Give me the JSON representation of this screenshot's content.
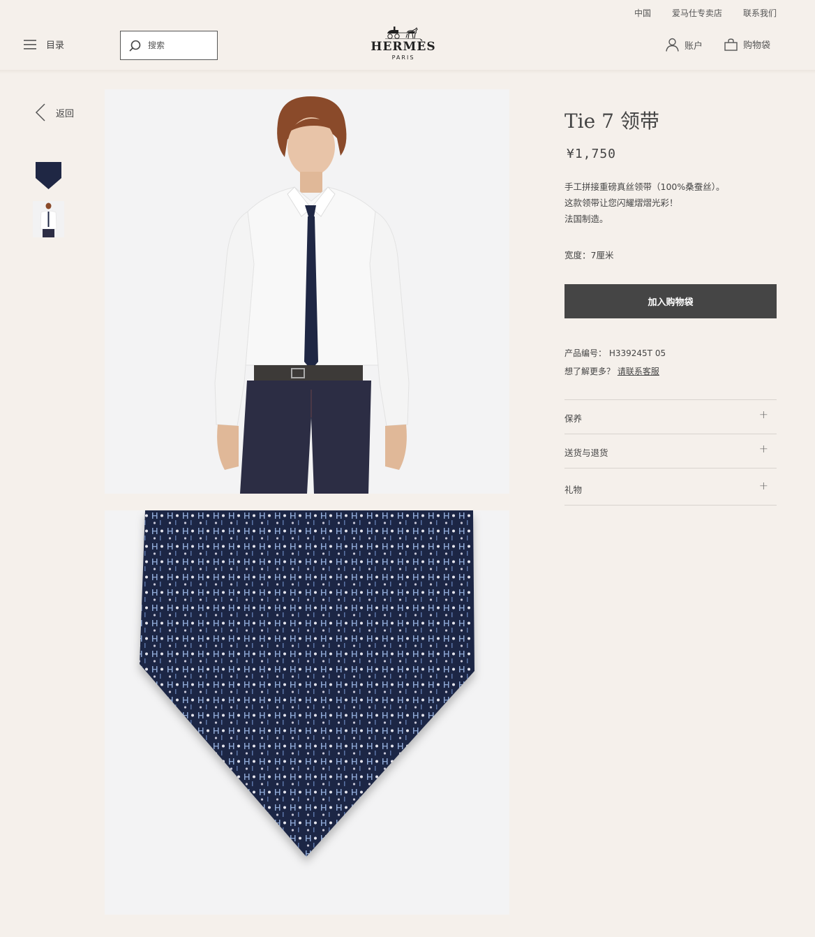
{
  "topbar": {
    "links": [
      "中国",
      "爱马仕专卖店",
      "联系我们"
    ]
  },
  "header": {
    "menu_label": "目录",
    "search_placeholder": "搜索",
    "logo_text": "HERMÈS",
    "logo_sub": "PARIS",
    "account_label": "账户",
    "bag_label": "购物袋"
  },
  "nav": {
    "back_label": "返回"
  },
  "product": {
    "title": "Tie 7 领带",
    "price": "¥1,750",
    "description": [
      "手工拼接重磅真丝领带（100%桑蚕丝）。",
      "这款领带让您闪耀熠熠光彩！",
      "法国制造。"
    ],
    "width": "宽度：7厘米",
    "add_to_bag": "加入购物袋",
    "sku_label": "产品编号：",
    "sku": "H339245T 05",
    "help_text": "想了解更多？",
    "help_link": "请联系客服",
    "accordions": [
      "保养",
      "送货与退货",
      "礼物"
    ]
  },
  "colors": {
    "background": "#f5f0eb",
    "button": "#454545",
    "tie_navy": "#1f2744",
    "pattern_light_blue": "#8fa9d6"
  },
  "icons": [
    "menu-icon",
    "search-icon",
    "hermes-carriage-logo",
    "user-icon",
    "shopping-bag-icon",
    "chevron-left-icon",
    "plus-icon"
  ]
}
